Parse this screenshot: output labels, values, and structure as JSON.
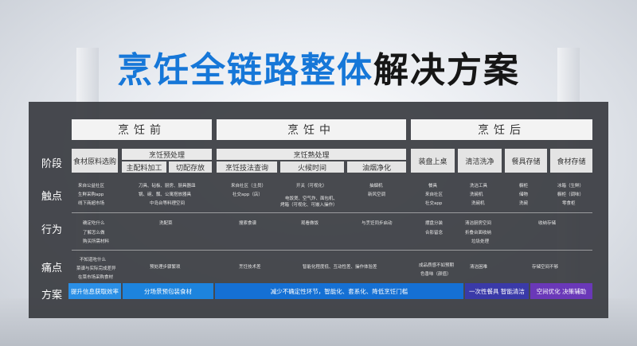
{
  "title": {
    "blue": "烹饪全链路整体",
    "dark": "解决方案"
  },
  "row_labels": {
    "stage": "阶段",
    "touch": "触点",
    "behavior": "行为",
    "pain": "痛点",
    "solution": "方案"
  },
  "stages": {
    "pre": "烹饪前",
    "mid": "烹饪中",
    "post": "烹饪后"
  },
  "stage_bars": {
    "pre_process": "烹饪预处理",
    "cook": "烹饪熟处理"
  },
  "subs": {
    "food": "食材原料选购",
    "main_prep": "主配料加工",
    "cut": "切配存放",
    "tech": "烹饪技法查询",
    "heat": "火候时间",
    "smoke": "油烟净化",
    "plate": "装盘上桌",
    "clean": "清洁洗净",
    "store_tools": "餐具存储",
    "store_food": "食材存储"
  },
  "touch": {
    "food": [
      "来自公益社区",
      "生鲜采购app",
      "线下商超市场"
    ],
    "prep": [
      "刀具、砧板、厨房、厨具器皿",
      "锅、碗、瓢、公寓搭放器具",
      "中岛台等料理空间"
    ],
    "tech": [
      "来自社区（主员）",
      "社交app（店）"
    ],
    "heat": [
      "开关（可视化）",
      "电饭煲、空气炸、面包机、",
      "烤箱（可视化、可嵌入操作）"
    ],
    "smoke": [
      "抽烟机",
      "新风空调"
    ],
    "plate": [
      "餐具",
      "来自社区",
      "社交app"
    ],
    "clean": [
      "洗洁工具",
      "洗碗机",
      "洗碗机"
    ],
    "tools": [
      "橱柜",
      "储物",
      "洗碗"
    ],
    "foodstore": [
      "冰箱（生鲜）",
      "橱柜（调味）",
      "零食柜"
    ]
  },
  "behavior": {
    "food": [
      "确定吃什么",
      "了解怎么做",
      "购买所需材料"
    ],
    "prep": "洗配菜",
    "tech": "搜索食谱",
    "heat": "观看做饭",
    "smoke": "与烹饪同步启动",
    "plate": [
      "摆盘分装",
      "合影留念"
    ],
    "clean": [
      "清洁厨房空间",
      "折叠台面收纳",
      "垃圾处理"
    ],
    "store": "收纳存储"
  },
  "pain": {
    "food": [
      "不知道吃什么",
      "菜谱与实际完成差异",
      "在菜市场采购食材"
    ],
    "prep": "预处理步骤繁琐",
    "tech": "烹饪技术差",
    "heat": "智能化程度低、互动性差、操作体验差",
    "plate": [
      "成品质感不如预期",
      "色香味（颜值）"
    ],
    "clean": "清洁困难",
    "store": "存储空间不够"
  },
  "solution": {
    "s1": "提升信息获取效率",
    "s2": "分场景预包装食材",
    "s3": "减少不确定性环节，智能化、套系化、降低烹饪门槛",
    "s4": "一次性餐具 智能清洁",
    "s5": "空间优化 决策辅助"
  },
  "colors": {
    "blue": "#1677d8",
    "sol1": "#2a8fe6",
    "sol2": "#1d84de",
    "sol3": "#1570d4",
    "sol4": "#3a3aa8",
    "sol5": "#6a38b8"
  }
}
